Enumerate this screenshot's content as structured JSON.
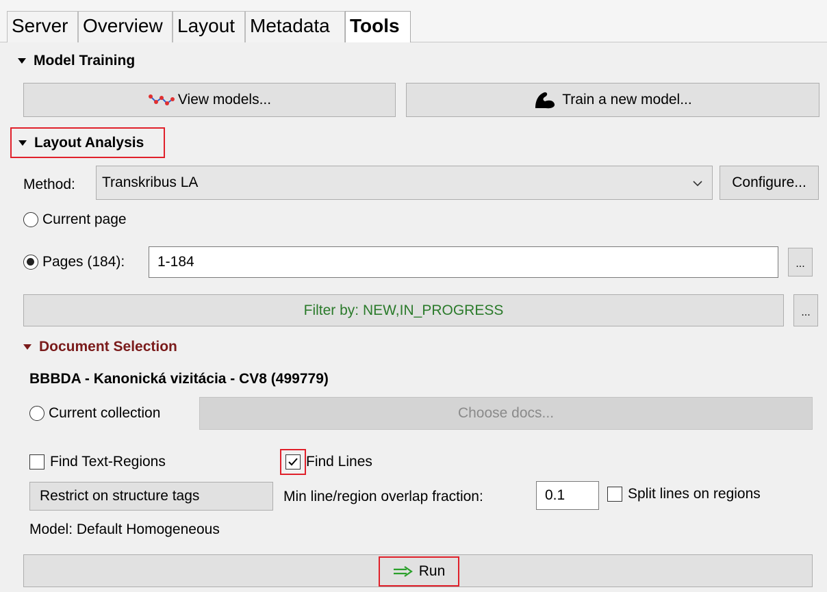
{
  "tabs": [
    "Server",
    "Overview",
    "Layout",
    "Metadata",
    "Tools"
  ],
  "active_tab": "Tools",
  "model_training": {
    "header": "Model Training",
    "view_models_label": "View models...",
    "train_model_label": "Train a new model..."
  },
  "layout_analysis": {
    "header": "Layout Analysis",
    "method_label": "Method:",
    "method_value": "Transkribus LA",
    "configure_label": "Configure...",
    "current_page_label": "Current page",
    "pages_label": "Pages (184):",
    "pages_value": "1-184",
    "pages_more_label": "...",
    "filter_label": "Filter by: NEW,IN_PROGRESS",
    "filter_more_label": "..."
  },
  "document_selection": {
    "header": "Document Selection",
    "document_title": "BBBDA - Kanonická vizitácia - CV8 (499779)",
    "current_collection_label": "Current collection",
    "choose_docs_label": "Choose docs..."
  },
  "options": {
    "find_text_regions_label": "Find Text-Regions",
    "find_text_regions_checked": false,
    "find_lines_label": "Find Lines",
    "find_lines_checked": true,
    "restrict_label": "Restrict on structure tags",
    "overlap_label": "Min line/region overlap fraction:",
    "overlap_value": "0.1",
    "split_lines_label": "Split lines on regions",
    "split_lines_checked": false,
    "model_label": "Model: Default Homogeneous"
  },
  "run_label": "Run",
  "colors": {
    "highlight": "#e0202a",
    "filter_text": "#2a7a2a",
    "doc_selection_header": "#7a1b1b",
    "run_arrow": "#2aa02a"
  }
}
